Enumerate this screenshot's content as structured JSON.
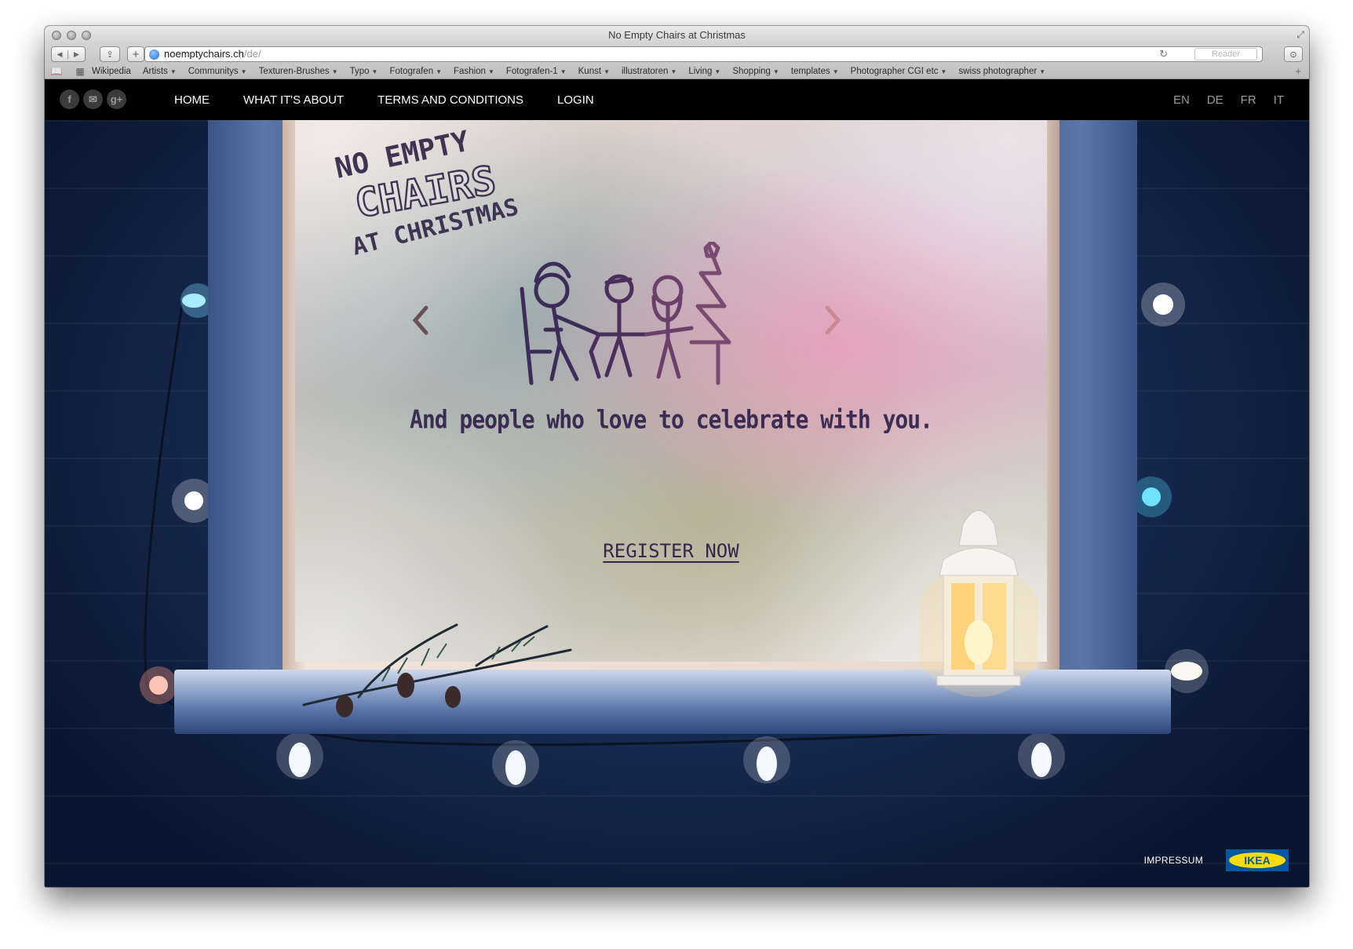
{
  "browser": {
    "window_title": "No Empty Chairs at Christmas",
    "url_host": "noemptychairs.ch",
    "url_path": "/de/",
    "reader_label": "Reader",
    "bookmarks": [
      {
        "label": "Wikipedia",
        "has_menu": false
      },
      {
        "label": "Artists",
        "has_menu": true
      },
      {
        "label": "Communitys",
        "has_menu": true
      },
      {
        "label": "Texturen-Brushes",
        "has_menu": true
      },
      {
        "label": "Typo",
        "has_menu": true
      },
      {
        "label": "Fotografen",
        "has_menu": true
      },
      {
        "label": "Fashion",
        "has_menu": true
      },
      {
        "label": "Fotografen-1",
        "has_menu": true
      },
      {
        "label": "Kunst",
        "has_menu": true
      },
      {
        "label": "illustratoren",
        "has_menu": true
      },
      {
        "label": "Living",
        "has_menu": true
      },
      {
        "label": "Shopping",
        "has_menu": true
      },
      {
        "label": "templates",
        "has_menu": true
      },
      {
        "label": "Photographer CGI etc",
        "has_menu": true
      },
      {
        "label": "swiss photographer",
        "has_menu": true
      }
    ]
  },
  "site": {
    "social_icons": [
      "facebook-icon",
      "email-icon",
      "google-plus-icon"
    ],
    "social_glyphs": [
      "f",
      "✉",
      "g+"
    ],
    "nav": [
      {
        "label": "HOME"
      },
      {
        "label": "WHAT IT'S ABOUT"
      },
      {
        "label": "TERMS AND CONDITIONS"
      },
      {
        "label": "LOGIN"
      }
    ],
    "languages": [
      "EN",
      "DE",
      "FR",
      "IT"
    ],
    "hero": {
      "logo_lines": [
        "NO EMPTY",
        "CHAIRS",
        "AT CHRISTMAS"
      ],
      "tagline": "And people who love to celebrate with you.",
      "cta": "REGISTER NOW"
    },
    "footer": {
      "impressum": "IMPRESSUM",
      "brand": "IKEA"
    }
  },
  "colors": {
    "nav_background": "#000000",
    "brand_blue": "#0058a3",
    "brand_yellow": "#ffdb00"
  }
}
